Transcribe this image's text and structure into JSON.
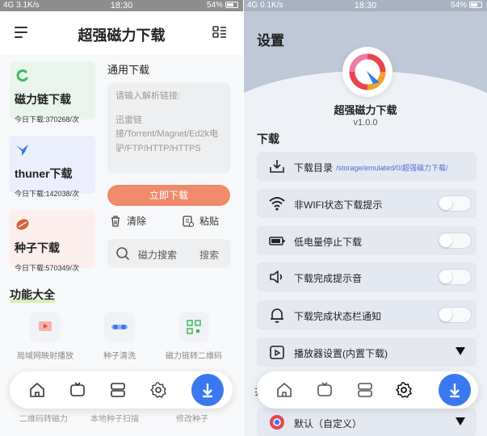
{
  "left": {
    "status": {
      "carrier": "4G",
      "speed": "3.1K/s",
      "time": "18:30",
      "battery": "54%"
    },
    "header": {
      "title": "超强磁力下载"
    },
    "cards": [
      {
        "title": "磁力链下载",
        "sub": "今日下载:370268/次",
        "icon_color": "#3dbb5b"
      },
      {
        "title": "thuner下载",
        "sub": "今日下载:142038/次",
        "icon_color": "#3a7be0"
      },
      {
        "title": "种子下载",
        "sub": "今日下载:570349/次",
        "icon_color": "#d2643c"
      }
    ],
    "download": {
      "title": "通用下载",
      "placeholder1": "请输入解析链接:",
      "placeholder2": "迅雷链接/Torrent/Magnet/Ed2k电驴/FTP/HTTP/HTTPS",
      "button": "立即下载",
      "clear": "清除",
      "paste": "粘贴"
    },
    "search": {
      "label": "磁力搜索",
      "button": "搜索"
    },
    "features": {
      "title": "功能大全",
      "items": [
        "局域网映射播放",
        "种子清洗",
        "磁力链转二维码"
      ],
      "row2": [
        "二维码转磁力",
        "本地种子扫描",
        "修改种子"
      ]
    }
  },
  "right": {
    "status": {
      "carrier": "4G",
      "speed": "0.1K/s",
      "time": "18:30",
      "battery": "54%"
    },
    "title": "设置",
    "app_name": "超强磁力下载",
    "version": "v1.0.0",
    "section": "下载",
    "rows": {
      "dir_label": "下载目录",
      "dir_path": "/storage/emulated/0/超强磁力下载/",
      "wifi": "非WIFI状态下载提示",
      "battery": "低电量停止下载",
      "sound": "下载完成提示音",
      "notify": "下载完成状态栏通知",
      "player": "播放器设置(内置下载)",
      "default": "默认（自定义）",
      "partial": "扌"
    }
  },
  "colors": {
    "accent": "#3a78f0",
    "download_button": "#f08a6a",
    "path_link": "#4a6fd8"
  }
}
